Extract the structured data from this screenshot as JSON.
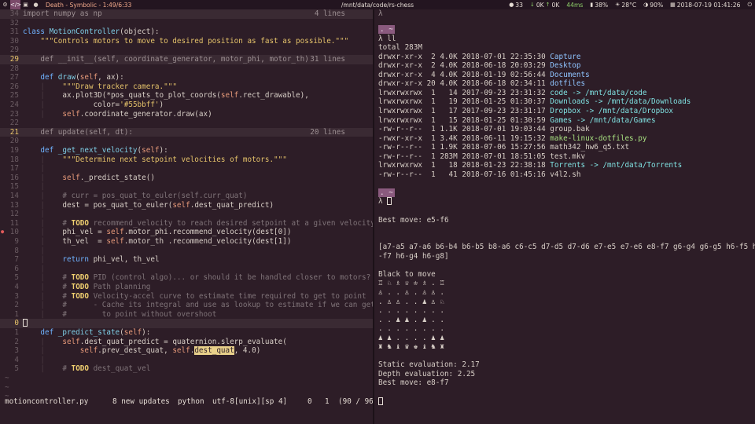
{
  "topbar": {
    "workspaces": [
      "⚙",
      "</>",
      "▣",
      "●"
    ],
    "active_workspace": 1,
    "now_playing": "Death - Symbolic - 1:49/6:33",
    "window_title": "/mnt/data/code/rs-chess",
    "tray": {
      "notifications": "33",
      "down": "0K",
      "up": "0K",
      "ping": "44ms",
      "battery": "38%",
      "temp": "28°C",
      "brightness": "90%",
      "datetime": "2018-07-19  01:41:26"
    }
  },
  "editor": {
    "filename": "motioncontroller.py",
    "updates": "8 new updates",
    "language": "python",
    "encoding": "utf-8[unix][sp 4]",
    "col": "0",
    "row": "1",
    "position": "(90 / 96)",
    "lines": [
      {
        "n": "34",
        "fold": true,
        "text": "import numpy as np",
        "info": "4 lines"
      },
      {
        "n": "32",
        "text": ""
      },
      {
        "n": "31",
        "segs": [
          [
            "kw",
            "class "
          ],
          [
            "cls",
            "MotionController"
          ],
          [
            "",
            "(object):"
          ]
        ]
      },
      {
        "n": "30",
        "segs": [
          [
            "guide",
            "    "
          ],
          [
            "str",
            "\"\"\"Controls motors to move to desired position as fast as possible.\"\"\""
          ]
        ]
      },
      {
        "n": "29",
        "text": ""
      },
      {
        "n": "29",
        "fold": true,
        "text": "    def __init__(self, coordinate_generator, motor_phi, motor_th)",
        "info": "31 lines",
        "cur": true
      },
      {
        "n": "28",
        "text": ""
      },
      {
        "n": "27",
        "segs": [
          [
            "",
            "    "
          ],
          [
            "kw",
            "def "
          ],
          [
            "fn",
            "draw"
          ],
          [
            "",
            "("
          ],
          [
            "self",
            "self"
          ],
          [
            "",
            ", ax):"
          ]
        ]
      },
      {
        "n": "26",
        "segs": [
          [
            "guide",
            "    | "
          ],
          [
            "",
            "   "
          ],
          [
            "str",
            "\"\"\"Draw tracker camera.\"\"\""
          ]
        ]
      },
      {
        "n": "25",
        "segs": [
          [
            "guide",
            "    | "
          ],
          [
            "",
            "   ax.plot3D(*pos_quats_to_plot_coords("
          ],
          [
            "self",
            "self"
          ],
          [
            "",
            ".rect_drawable),"
          ]
        ]
      },
      {
        "n": "24",
        "segs": [
          [
            "guide",
            "    | "
          ],
          [
            "",
            "          color="
          ],
          [
            "str",
            "'#55bbff'"
          ],
          [
            "",
            ")"
          ]
        ]
      },
      {
        "n": "23",
        "segs": [
          [
            "guide",
            "    | "
          ],
          [
            "",
            "   "
          ],
          [
            "self",
            "self"
          ],
          [
            "",
            ".coordinate_generator.draw(ax)"
          ]
        ]
      },
      {
        "n": "22",
        "text": ""
      },
      {
        "n": "21",
        "fold": true,
        "text": "    def update(self, dt):",
        "info": "20 lines",
        "cur": true
      },
      {
        "n": "20",
        "text": ""
      },
      {
        "n": "19",
        "segs": [
          [
            "",
            "    "
          ],
          [
            "kw",
            "def "
          ],
          [
            "fn",
            "_get_next_velocity"
          ],
          [
            "",
            "("
          ],
          [
            "self",
            "self"
          ],
          [
            "",
            "):"
          ]
        ]
      },
      {
        "n": "18",
        "segs": [
          [
            "guide",
            "    | "
          ],
          [
            "",
            "   "
          ],
          [
            "str",
            "\"\"\"Determine next setpoint velocities of motors.\"\"\""
          ]
        ]
      },
      {
        "n": "17",
        "segs": [
          [
            "guide",
            "    | "
          ]
        ]
      },
      {
        "n": "16",
        "segs": [
          [
            "guide",
            "    | "
          ],
          [
            "",
            "   "
          ],
          [
            "self",
            "self"
          ],
          [
            "",
            "._predict_state()"
          ]
        ]
      },
      {
        "n": "15",
        "segs": [
          [
            "guide",
            "    | "
          ]
        ]
      },
      {
        "n": "14",
        "segs": [
          [
            "guide",
            "    | "
          ],
          [
            "",
            "   "
          ],
          [
            "com",
            "# curr = pos_quat_to_euler(self.curr_quat)"
          ]
        ]
      },
      {
        "n": "13",
        "segs": [
          [
            "guide",
            "    | "
          ],
          [
            "",
            "   dest = pos_quat_to_euler("
          ],
          [
            "self",
            "self"
          ],
          [
            "",
            ".dest_quat_predict)"
          ]
        ]
      },
      {
        "n": "12",
        "segs": [
          [
            "guide",
            "    | "
          ]
        ]
      },
      {
        "n": "11",
        "segs": [
          [
            "guide",
            "    | "
          ],
          [
            "",
            "   "
          ],
          [
            "com",
            "# "
          ],
          [
            "todo",
            "TODO"
          ],
          [
            "com",
            " recommend_velocity to reach desired setpoint at a given velocity"
          ]
        ]
      },
      {
        "n": "10",
        "err": true,
        "segs": [
          [
            "guide",
            "    | "
          ],
          [
            "",
            "   phi_vel = "
          ],
          [
            "self",
            "self"
          ],
          [
            "",
            ".motor_phi.recommend_velocity(dest["
          ],
          [
            "num",
            "0"
          ],
          [
            "",
            "])"
          ]
        ]
      },
      {
        "n": "9",
        "segs": [
          [
            "guide",
            "    | "
          ],
          [
            "",
            "   th_vel  = "
          ],
          [
            "self",
            "self"
          ],
          [
            "",
            ".motor_th .recommend_velocity(dest["
          ],
          [
            "num",
            "1"
          ],
          [
            "",
            "])"
          ]
        ]
      },
      {
        "n": "8",
        "segs": [
          [
            "guide",
            "    | "
          ]
        ]
      },
      {
        "n": "7",
        "segs": [
          [
            "guide",
            "    | "
          ],
          [
            "",
            "   "
          ],
          [
            "kw",
            "return "
          ],
          [
            "",
            "phi_vel, th_vel"
          ]
        ]
      },
      {
        "n": "6",
        "segs": [
          [
            "guide",
            "    | "
          ]
        ]
      },
      {
        "n": "5",
        "segs": [
          [
            "guide",
            "    | "
          ],
          [
            "",
            "   "
          ],
          [
            "com",
            "# "
          ],
          [
            "todo",
            "TODO"
          ],
          [
            "com",
            " PID (control algo)... or should it be handled closer to motors?"
          ]
        ]
      },
      {
        "n": "4",
        "segs": [
          [
            "guide",
            "    | "
          ],
          [
            "",
            "   "
          ],
          [
            "com",
            "# "
          ],
          [
            "todo",
            "TODO"
          ],
          [
            "com",
            " Path planning"
          ]
        ]
      },
      {
        "n": "3",
        "segs": [
          [
            "guide",
            "    | "
          ],
          [
            "",
            "   "
          ],
          [
            "com",
            "# "
          ],
          [
            "todo",
            "TODO"
          ],
          [
            "com",
            " Velocity-accel curve to estimate time required to get to point"
          ]
        ]
      },
      {
        "n": "2",
        "segs": [
          [
            "guide",
            "    | "
          ],
          [
            "",
            "   "
          ],
          [
            "com",
            "#      - Cache its integral and use as lookup to estimate if we can get"
          ]
        ]
      },
      {
        "n": "1",
        "segs": [
          [
            "guide",
            "    | "
          ],
          [
            "",
            "   "
          ],
          [
            "com",
            "#        to point without overshoot"
          ]
        ]
      },
      {
        "n": "0",
        "cursor": true,
        "segs": [
          [
            "",
            ""
          ]
        ]
      },
      {
        "n": "1",
        "segs": [
          [
            "",
            "    "
          ],
          [
            "kw",
            "def "
          ],
          [
            "fn",
            "_predict_state"
          ],
          [
            "",
            "("
          ],
          [
            "self",
            "self"
          ],
          [
            "",
            "):"
          ]
        ]
      },
      {
        "n": "2",
        "segs": [
          [
            "guide",
            "    | "
          ],
          [
            "",
            "   "
          ],
          [
            "self",
            "self"
          ],
          [
            "",
            ".dest_quat_predict = quaternion.slerp_evaluate("
          ]
        ]
      },
      {
        "n": "3",
        "segs": [
          [
            "guide",
            "    | "
          ],
          [
            "",
            "       "
          ],
          [
            "self",
            "self"
          ],
          [
            "",
            ".prev_dest_quat, "
          ],
          [
            "self",
            "self"
          ],
          [
            "",
            "."
          ],
          [
            "hl",
            "dest_quat"
          ],
          [
            "",
            ", "
          ],
          [
            "num",
            "4.0"
          ],
          [
            "",
            ")"
          ]
        ]
      },
      {
        "n": "4",
        "segs": [
          [
            "guide",
            "    | "
          ]
        ]
      },
      {
        "n": "5",
        "segs": [
          [
            "guide",
            "    | "
          ],
          [
            "",
            "   "
          ],
          [
            "com",
            "# "
          ],
          [
            "todo",
            "TODO"
          ],
          [
            "com",
            " dest_quat_vel"
          ]
        ]
      }
    ],
    "tildes": 3
  },
  "terminal": {
    "title": "λ",
    "lines": [
      {
        "type": "badge",
        "text": ". ~"
      },
      {
        "type": "prompt",
        "prompt": "λ",
        "cmd": "ll"
      },
      {
        "type": "plain",
        "text": "total 283M"
      },
      {
        "type": "ls",
        "meta": "drwxr-xr-x  2 4.0K 2018-07-01 22:35:30 ",
        "name": "Capture",
        "kind": "dir"
      },
      {
        "type": "ls",
        "meta": "drwxr-xr-x  2 4.0K 2018-06-18 20:03:29 ",
        "name": "Desktop",
        "kind": "dir"
      },
      {
        "type": "ls",
        "meta": "drwxr-xr-x  4 4.0K 2018-01-19 02:56:44 ",
        "name": "Documents",
        "kind": "dir"
      },
      {
        "type": "ls",
        "meta": "drwxr-xr-x 20 4.0K 2018-06-18 02:34:11 ",
        "name": "dotfiles",
        "kind": "dir"
      },
      {
        "type": "ls",
        "meta": "lrwxrwxrwx  1   14 2017-09-23 23:31:32 ",
        "name": "code -> /mnt/data/code",
        "kind": "lnk"
      },
      {
        "type": "ls",
        "meta": "lrwxrwxrwx  1   19 2018-01-25 01:30:37 ",
        "name": "Downloads -> /mnt/data/Downloads",
        "kind": "lnk"
      },
      {
        "type": "ls",
        "meta": "lrwxrwxrwx  1   17 2017-09-23 23:31:17 ",
        "name": "Dropbox -> /mnt/data/Dropbox",
        "kind": "lnk"
      },
      {
        "type": "ls",
        "meta": "lrwxrwxrwx  1   15 2018-01-25 01:30:59 ",
        "name": "Games -> /mnt/data/Games",
        "kind": "lnk"
      },
      {
        "type": "ls",
        "meta": "-rw-r--r--  1 1.1K 2018-07-01 19:03:44 ",
        "name": "group.bak",
        "kind": "file"
      },
      {
        "type": "ls",
        "meta": "-rwxr-xr-x  1 3.4K 2018-06-11 19:15:32 ",
        "name": "make-linux-dotfiles.py",
        "kind": "exe"
      },
      {
        "type": "ls",
        "meta": "-rw-r--r--  1 1.9K 2018-07-06 15:27:56 ",
        "name": "math342_hw6_q5.txt",
        "kind": "file"
      },
      {
        "type": "ls",
        "meta": "-rw-r--r--  1 283M 2018-07-01 18:51:05 ",
        "name": "test.mkv",
        "kind": "file"
      },
      {
        "type": "ls",
        "meta": "lrwxrwxrwx  1   18 2018-01-23 22:38:18 ",
        "name": "Torrents -> /mnt/data/Torrents",
        "kind": "lnk"
      },
      {
        "type": "ls",
        "meta": "-rw-r--r--  1   41 2018-07-16 01:45:16 ",
        "name": "v4l2.sh",
        "kind": "file"
      },
      {
        "type": "blank"
      },
      {
        "type": "badge",
        "text": ". ~"
      },
      {
        "type": "prompt",
        "prompt": "λ",
        "cmd": "",
        "cursor": true
      },
      {
        "type": "blank"
      },
      {
        "type": "plain",
        "text": "Best move: e5-f6"
      },
      {
        "type": "blank"
      },
      {
        "type": "blank"
      },
      {
        "type": "plain",
        "text": "[a7-a5 a7-a6 b6-b4 b6-b5 b8-a6 c6-c5 d7-d5 d7-d6 e7-e5 e7-e6 e8-f7 g6-g4 g6-g5 h6-f5 h6"
      },
      {
        "type": "plain",
        "text": "-f7 h6-g4 h6-g8]"
      },
      {
        "type": "blank"
      },
      {
        "type": "plain",
        "text": "Black to move"
      },
      {
        "type": "plain",
        "text": "♖ ♘ ♗ ♕ ♔ ♗ . ♖"
      },
      {
        "type": "plain",
        "text": "♙ . . ♙ . ♙ ♙ ."
      },
      {
        "type": "plain",
        "text": ". ♙ ♙ . . ♟ ♙ ♘"
      },
      {
        "type": "plain",
        "text": ". . . . . . . ."
      },
      {
        "type": "plain",
        "text": ". . ♟ ♟ . ♟ . ."
      },
      {
        "type": "plain",
        "text": ". . . . . . . ."
      },
      {
        "type": "plain",
        "text": "♟ ♟ . . . . ♟ ♟"
      },
      {
        "type": "plain",
        "text": "♜ ♞ ♝ ♛ ♚ ♝ ♞ ♜"
      },
      {
        "type": "blank"
      },
      {
        "type": "plain",
        "text": "Static evaluation: 2.17"
      },
      {
        "type": "plain",
        "text": "Depth evaluation: 2.25"
      },
      {
        "type": "plain",
        "text": "Best move: e8-f7"
      },
      {
        "type": "blank"
      },
      {
        "type": "cursor"
      }
    ]
  }
}
